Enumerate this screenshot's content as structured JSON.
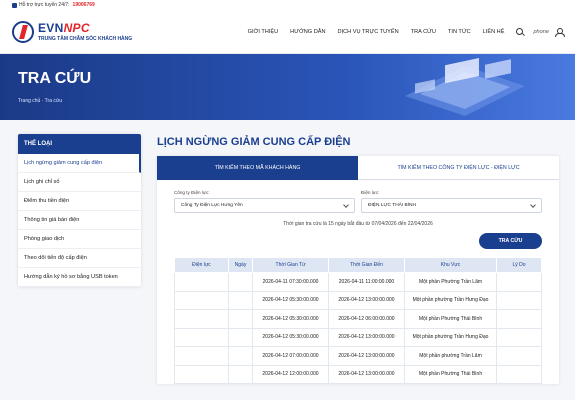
{
  "topbar": {
    "support_label": "Hỗ trợ trực tuyến 24/7:",
    "hotline": "19006769"
  },
  "logo": {
    "brand_a": "EVN",
    "brand_b": "NPC",
    "subtitle": "TRUNG TÂM CHĂM SÓC KHÁCH HÀNG"
  },
  "nav": {
    "items": [
      "GIỚI THIỆU",
      "HƯỚNG DẪN",
      "DỊCH VỤ TRỰC TUYẾN",
      "TRA CỨU",
      "TIN TỨC",
      "LIÊN HỆ"
    ],
    "phone": "phone"
  },
  "banner": {
    "title": "TRA CỨU",
    "breadcrumb": "Trang chủ  ·  Tra cứu"
  },
  "sidebar": {
    "header": "THỂ LOẠI",
    "items": [
      "Lịch ngừng giảm cung cấp điện",
      "Lịch ghi chỉ số",
      "Điểm thu tiền điện",
      "Thông tin giá bán điện",
      "Phòng giao dịch",
      "Theo dõi tiến độ cấp điện",
      "Hướng dẫn ký hồ sơ bằng USB token"
    ]
  },
  "main": {
    "title": "LỊCH NGỪNG GIẢM CUNG CẤP ĐIỆN",
    "tabs": [
      "TÌM KIẾM THEO MÃ KHÁCH HÀNG",
      "TÌM KIẾM THEO CÔNG TY ĐIỆN LỰC - ĐIỆN LỰC"
    ],
    "company_label": "Công ty Điện lực:",
    "company_value": "Công Ty Điện Lực Hưng Yên",
    "branch_label": "Điện lực:",
    "branch_value": "ĐIỆN LỰC THÁI BÌNH",
    "note": "Thời gian tra cứu là 15 ngày bắt đầu từ 07/04/2026 đến 22/04/2026",
    "search_button": "TRA CỨU",
    "table": {
      "headers": [
        "Điện lực",
        "Ngày",
        "Thời Gian Từ",
        "Thời Gian Đến",
        "Khu Vực",
        "Lý Do"
      ],
      "rows": [
        [
          "",
          "",
          "2026-04-11 07:30:00.000",
          "2026-04-11 11:00:00.000",
          "Một phần Phường Trần Lãm",
          ""
        ],
        [
          "",
          "",
          "2026-04-12 05:30:00.000",
          "2026-04-12 13:00:00.000",
          "Một phần phường Trần Hưng Đạo",
          ""
        ],
        [
          "",
          "",
          "2026-04-12 05:30:00.000",
          "2026-04-12 06:00:00.000",
          "Một phần Phường Thái Bình",
          ""
        ],
        [
          "",
          "",
          "2026-04-12 05:30:00.000",
          "2026-04-12 13:00:00.000",
          "Một phần phường Trần Hưng Đạo",
          ""
        ],
        [
          "",
          "",
          "2026-04-12 07:00:00.000",
          "2026-04-12 13:00:00.000",
          "Một phần phường Trần Lãm",
          ""
        ],
        [
          "",
          "",
          "2026-04-12 12:00:00.000",
          "2026-04-12 13:00:00.000",
          "Một phần Phường Thái Bình",
          ""
        ]
      ]
    }
  }
}
